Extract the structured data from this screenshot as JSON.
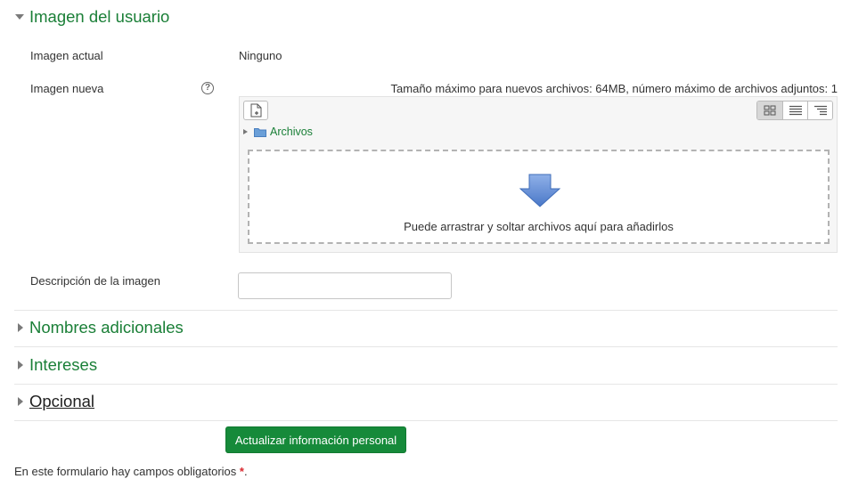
{
  "sections": {
    "user_image": {
      "title": "Imagen del usuario",
      "expanded": true
    },
    "additional_names": {
      "title": "Nombres adicionales",
      "expanded": false
    },
    "interests": {
      "title": "Intereses",
      "expanded": false
    },
    "optional": {
      "title": "Opcional",
      "expanded": false
    }
  },
  "form": {
    "current_image_label": "Imagen actual",
    "current_image_value": "Ninguno",
    "new_image_label": "Imagen nueva",
    "file_limits": "Tamaño máximo para nuevos archivos: 64MB, número máximo de archivos adjuntos: 1",
    "folder_label": "Archivos",
    "dropzone_text": "Puede arrastrar y soltar archivos aquí para añadirlos",
    "description_label": "Descripción de la imagen",
    "description_value": "",
    "help_symbol": "?"
  },
  "actions": {
    "submit_label": "Actualizar información personal"
  },
  "footer": {
    "required_note": "En este formulario hay campos obligatorios",
    "required_marker": "*",
    "period": "."
  },
  "icons": {
    "collapse": "caret-down-icon",
    "expand": "caret-right-icon",
    "help": "help-icon",
    "add_file": "add-file-icon",
    "view_icons": "grid-view-icon",
    "view_list": "list-view-icon",
    "view_tree": "tree-view-icon",
    "folder": "folder-icon",
    "drop_arrow": "down-arrow-icon"
  },
  "colors": {
    "accent_green": "#1a7f37",
    "button_green": "#168a3a",
    "required_red": "#d9272e"
  }
}
